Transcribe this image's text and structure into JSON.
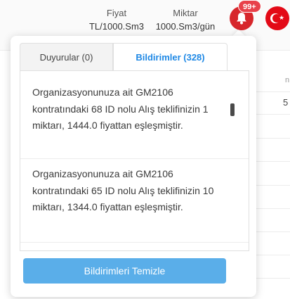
{
  "header": {
    "price_title": "Fiyat",
    "price_unit": "TL/1000.Sm3",
    "qty_title": "Miktar",
    "qty_unit": "1000.Sm3/gün",
    "notification_badge": "99+",
    "bell_color": "#d7262b",
    "flag_color": "#e30a17"
  },
  "background_table": {
    "col_header_fragment": "n",
    "cell_fragment": "5"
  },
  "panel": {
    "tabs": [
      {
        "label": "Duyurular (0)",
        "active": false
      },
      {
        "label": "Bildirimler (328)",
        "active": true
      }
    ],
    "notifications": [
      {
        "text": "Organizasyonunuza ait GM2106 kontratındaki 68 ID nolu Alış teklifinizin 1 miktarı, 1444.0 fiyattan eşleşmiştir."
      },
      {
        "text": "Organizasyonunuza ait GM2106 kontratındaki 65 ID nolu Alış teklifinizin 10 miktarı, 1344.0 fiyattan eşleşmiştir."
      }
    ],
    "clear_button_label": "Bildirimleri Temizle",
    "accent_color": "#1e88e5",
    "button_color": "#5aaee9"
  }
}
